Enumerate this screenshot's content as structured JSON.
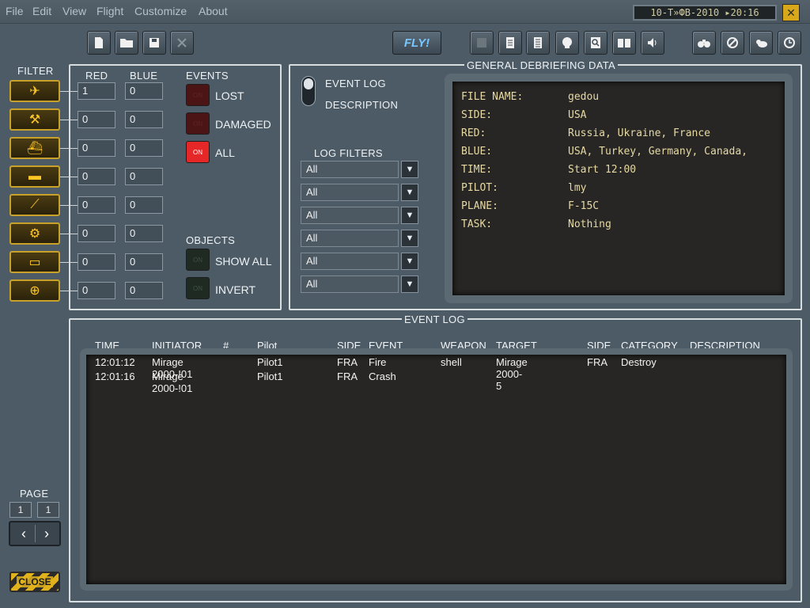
{
  "menu": [
    "File",
    "Edit",
    "View",
    "Flight",
    "Customize",
    "About"
  ],
  "datetime": "10-Т»ФВ-2010 ▸20:16",
  "close_x": "✕",
  "toolbar": {
    "fly_label": "FLY!"
  },
  "filter": {
    "title": "FILTER",
    "red_label": "RED",
    "blue_label": "BLUE",
    "rows": [
      {
        "name": "airplane",
        "icon": "✈",
        "red": "1",
        "blue": "0"
      },
      {
        "name": "helicopter",
        "icon": "⚒",
        "red": "0",
        "blue": "0"
      },
      {
        "name": "ship",
        "icon": "⛴",
        "red": "0",
        "blue": "0"
      },
      {
        "name": "tank",
        "icon": "▬",
        "red": "0",
        "blue": "0"
      },
      {
        "name": "sam-launcher",
        "icon": "⟋",
        "red": "0",
        "blue": "0"
      },
      {
        "name": "radar-vehicle",
        "icon": "⚙",
        "red": "0",
        "blue": "0"
      },
      {
        "name": "truck",
        "icon": "▭",
        "red": "0",
        "blue": "0"
      },
      {
        "name": "target",
        "icon": "⊕",
        "red": "0",
        "blue": "0"
      }
    ]
  },
  "events": {
    "title": "EVENTS",
    "lost": "LOST",
    "damaged": "DAMAGED",
    "all": "ALL",
    "on_text": "ON"
  },
  "objects": {
    "title": "OBJECTS",
    "show_all": "SHOW ALL",
    "invert": "INVERT"
  },
  "general": {
    "title": "GENERAL DEBRIEFING DATA",
    "event_log": "EVENT LOG",
    "description": "DESCRIPTION",
    "log_filters": "LOG FILTERS",
    "filters": [
      "All",
      "All",
      "All",
      "All",
      "All",
      "All"
    ],
    "info": [
      {
        "key": "FILE NAME:",
        "value": "gedou"
      },
      {
        "key": "SIDE:",
        "value": "USA"
      },
      {
        "key": "RED:",
        "value": "Russia, Ukraine, France"
      },
      {
        "key": "BLUE:",
        "value": "USA, Turkey, Germany, Canada,"
      },
      {
        "key": "TIME:",
        "value": "Start 12:00"
      },
      {
        "key": "PILOT:",
        "value": "lmy"
      },
      {
        "key": "PLANE:",
        "value": "F-15C"
      },
      {
        "key": "TASK:",
        "value": "Nothing"
      }
    ]
  },
  "event_log": {
    "title": "EVENT LOG",
    "headers": [
      "TIME",
      "INITIATOR",
      "#",
      "Pilot",
      "SIDE",
      "EVENT",
      "WEAPON",
      "TARGET",
      "SIDE",
      "CATEGORY",
      "DESCRIPTION"
    ],
    "rows": [
      {
        "time": "12:01:12",
        "initiator": "Mirage 2000-!01",
        "pilot": "Pilot1",
        "side": "FRA",
        "event": "Fire",
        "weapon": "shell",
        "target": "Mirage 2000-5",
        "tside": "FRA",
        "category": "Destroy"
      },
      {
        "time": "12:01:16",
        "initiator": "Mirage 2000-!01",
        "pilot": "Pilot1",
        "side": "FRA",
        "event": "Crash",
        "weapon": "",
        "target": "",
        "tside": "",
        "category": ""
      }
    ]
  },
  "page": {
    "title": "PAGE",
    "current": "1",
    "total": "1"
  },
  "close_label": "CLOSE"
}
